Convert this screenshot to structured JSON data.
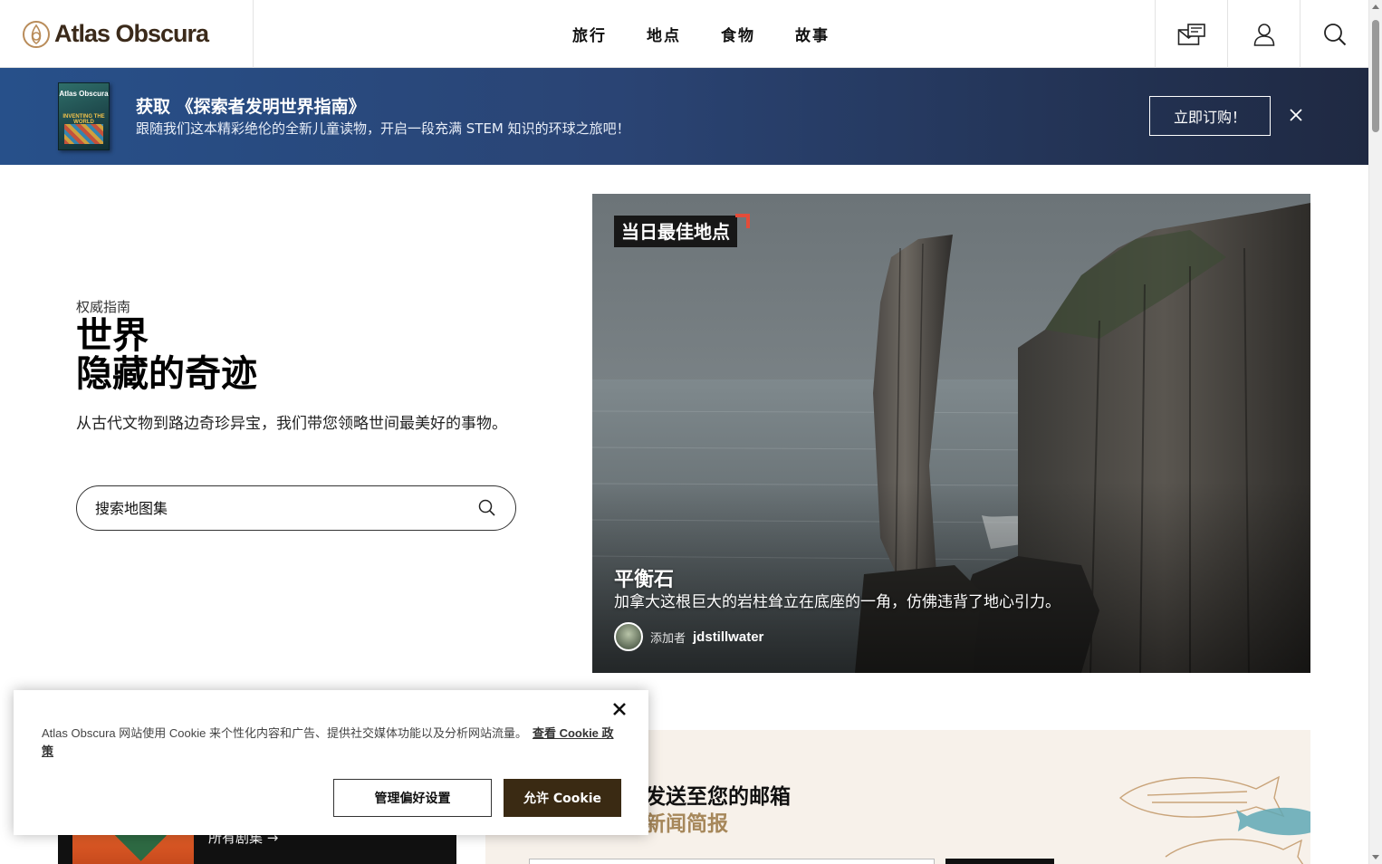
{
  "header": {
    "logo_text": "Atlas Obscura",
    "nav": [
      {
        "label": "旅行"
      },
      {
        "label": "地点"
      },
      {
        "label": "食物"
      },
      {
        "label": "故事"
      }
    ],
    "icons": [
      "newsletter-icon",
      "user-icon",
      "search-icon"
    ]
  },
  "banner": {
    "book_cover": {
      "title": "Atlas Obscura",
      "subtitle": "INVENTING THE WORLD"
    },
    "title": "获取 《探索者发明世界指南》",
    "subtitle": "跟随我们这本精彩绝伦的全新儿童读物，开启一段充满 STEM 知识的环球之旅吧！",
    "cta_label": "立即订购！",
    "close_icon": "close-icon"
  },
  "hero": {
    "kicker": "权威指南",
    "title_line1": "世界",
    "title_line2": "隐藏的奇迹",
    "description": "从古代文物到路边奇珍异宝，我们带您领略世间最美好的事物。",
    "search_placeholder": "搜索地图集"
  },
  "featured": {
    "tag": "当日最佳地点",
    "name": "平衡石",
    "description": "加拿大这根巨大的岩柱耸立在底座的一角，仿佛违背了地心引力。",
    "added_by_label": "添加者",
    "author": "jdstillwater"
  },
  "newsletter": {
    "title_partial": "发送至您的邮箱",
    "subtitle_partial": "新闻简报"
  },
  "podcast": {
    "link_label": "所有剧集 →"
  },
  "cookie": {
    "text": "Atlas Obscura 网站使用 Cookie 来个性化内容和广告、提供社交媒体功能以及分析网站流量。",
    "link_label": "查看 Cookie 政策",
    "manage_label": "管理偏好设置",
    "allow_label": "允许 Cookie"
  },
  "colors": {
    "brand_brown": "#3b2a1a",
    "banner_blue": "#27508a",
    "cookie_allow_bg": "#3a2a13",
    "tag_accent": "#e34c3a"
  }
}
